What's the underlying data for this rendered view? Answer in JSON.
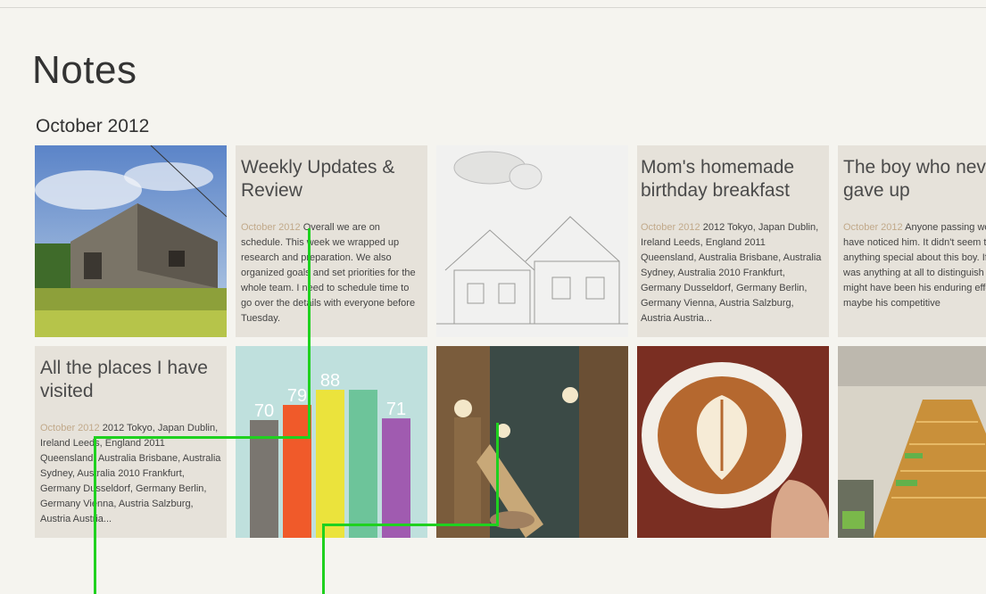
{
  "app": {
    "title": "Notes"
  },
  "section": {
    "heading": "October 2012"
  },
  "notes": [
    {
      "title": "Weekly Updates & Review",
      "date": "October 2012",
      "body": "Overall we are on schedule. This week we wrapped up research and preparation. We also organized goals and set priorities for the whole team. I need to schedule time to go over the details with everyone before Tuesday."
    },
    {
      "title": "Mom's homemade birthday breakfast",
      "date": "October 2012",
      "body": "2012 Tokyo, Japan Dublin, Ireland Leeds, England 2011 Queensland, Australia Brisbane, Australia Sydney, Australia 2010 Frankfurt, Germany Dusseldorf, Germany Berlin, Germany Vienna, Austria Salzburg, Austria Austria..."
    },
    {
      "title": "The boy who never gave up",
      "date": "October 2012",
      "body": "Anyone passing would not have noticed him. It didn't seem to be anything special about this boy. If there was anything at all to distinguish him, might have been his enduring effort. Or maybe his competitive"
    },
    {
      "title": "All the places I have visited",
      "date": "October 2012",
      "body": "2012 Tokyo, Japan Dublin, Ireland Leeds, England 2011 Queensland, Australia Brisbane, Australia Sydney, Australia 2010 Frankfurt, Germany Dusseldorf, Germany Berlin, Germany Vienna, Austria Salzburg, Austria Austria..."
    }
  ],
  "images": [
    {
      "subject": "barn-photo"
    },
    {
      "subject": "house-sketch-photo"
    },
    {
      "subject": "bar-chart-image"
    },
    {
      "subject": "atrium-photo"
    },
    {
      "subject": "latte-photo"
    },
    {
      "subject": "office-stairs-photo"
    }
  ],
  "chart_data": {
    "type": "bar",
    "categories": [
      "",
      "",
      "",
      "",
      ""
    ],
    "values": [
      70,
      79,
      88,
      88,
      71
    ],
    "value_labels": [
      "70",
      "79",
      "88",
      "",
      "71"
    ],
    "colors": [
      "#7a7670",
      "#f05a2a",
      "#ebe33c",
      "#6dc49a",
      "#a05bb0"
    ],
    "background": "#bfe0dd",
    "ylim": [
      0,
      100
    ]
  },
  "colors": {
    "accent_date": "#c1a98a",
    "tile_bg": "#e6e2da",
    "guide": "#1fd11f"
  }
}
